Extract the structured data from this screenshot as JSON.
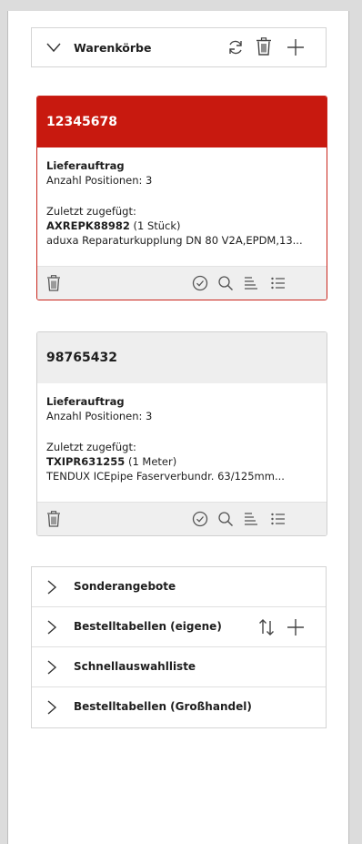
{
  "header": {
    "title": "Warenkörbe",
    "icons": [
      "chevron-down-icon",
      "refresh-icon",
      "trash-icon",
      "plus-icon"
    ]
  },
  "carts": [
    {
      "number": "12345678",
      "type": "Lieferauftrag",
      "positions": "Anzahl Positionen: 3",
      "last_added_label": "Zuletzt zugefügt:",
      "item_code": "AXREPK88982",
      "item_qty": "(1 Stück)",
      "item_desc": "aduxa Reparaturkupplung DN 80 V2A,EPDM,13...",
      "active": true
    },
    {
      "number": "98765432",
      "type": "Lieferauftrag",
      "positions": "Anzahl Positionen: 3",
      "last_added_label": "Zuletzt zugefügt:",
      "item_code": "TXIPR631255",
      "item_qty": "(1 Meter)",
      "item_desc": "TENDUX ICEpipe Faserverbundr. 63/125mm...",
      "active": false
    }
  ],
  "sections": [
    {
      "label": "Sonderangebote"
    },
    {
      "label": "Bestelltabellen (eigene)"
    },
    {
      "label": "Schnellauswahlliste"
    },
    {
      "label": "Bestelltabellen (Großhandel)"
    }
  ],
  "colors": {
    "accent": "#c8190f",
    "header_grey": "#eeeeee",
    "footer_grey": "#efefef"
  }
}
